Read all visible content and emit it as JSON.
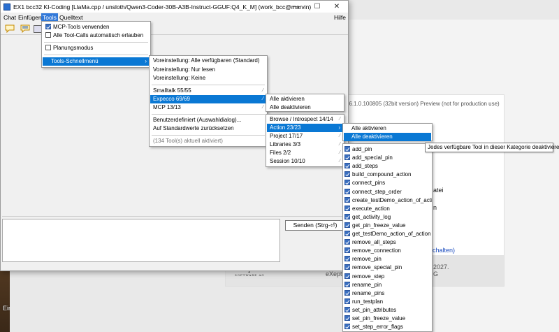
{
  "desktop": {
    "label": "Einga"
  },
  "background_app": {
    "version_text": "26.1.0.100805 (32bit version) Preview (not for production use)",
    "fragment_1": "atei",
    "fragment_2": "n",
    "link_fragment": "chalten)",
    "footer_1": "2027.",
    "footer_2": "G",
    "logo_text": "eXept",
    "logo_sub": "SOFTWARE AG",
    "logo_fragment": "eXept"
  },
  "window": {
    "title": "EX1 bcc32 KI-Coding [LlaMa.cpp / unsloth/Qwen3-Coder-30B-A3B-Instruct-GGUF:Q4_K_M] (work_bcc@marvin)",
    "controls": {
      "minimize": "—",
      "maximize": "☐",
      "close": "✕"
    }
  },
  "menubar": {
    "chat": "Chat",
    "einfuegen": "Einfügen",
    "tools": "Tools",
    "quelltext": "Quelltext",
    "hilfe": "Hilfe"
  },
  "toolbar": {
    "icons": [
      "speech-bubble-icon",
      "speech-bubble-list-icon",
      "window-icon"
    ]
  },
  "input": {
    "value": ""
  },
  "send_button": "Senden (Strg-⏎)",
  "tools_menu": {
    "mcp_tools": "MCP-Tools verwenden",
    "auto_allow": "Alle Tool-Calls automatisch erlauben",
    "planning_mode": "Planungsmodus",
    "quick_menu": "Tools-Schnellmenü",
    "quick_menu_arrow": "›"
  },
  "tools_submenu": {
    "preset_all": "Voreinstellung: Alle verfügbaren (Standard)",
    "preset_read": "Voreinstellung: Nur lesen",
    "preset_none": "Voreinstellung: Keine",
    "smalltalk": "Smalltalk  55/55",
    "expecco": "Expecco  69/69",
    "mcp": "MCP  13/13",
    "custom": "Benutzerdefiniert (Auswahldialog)...",
    "reset": "Auf Standardwerte zurücksetzen",
    "status": "(134 Tool(s) aktuell aktiviert)"
  },
  "expecco_menu": {
    "enable_all": "Alle aktivieren",
    "disable_all": "Alle deaktivieren"
  },
  "category_menu": {
    "browse": "Browse / Introspect  14/14",
    "action": "Action  23/23",
    "project": "Project  17/17",
    "libraries": "Libraries  3/3",
    "files": "Files  2/2",
    "session": "Session  10/10"
  },
  "action_menu": {
    "enable_all": "Alle aktivieren",
    "disable_all": "Alle deaktivieren"
  },
  "tooltip": "Jedes verfügbare Tool in dieser Kategorie deaktivieren",
  "tools": [
    "add_pin",
    "add_special_pin",
    "add_steps",
    "build_compound_action",
    "connect_pins",
    "connect_step_order",
    "create_testDemo_action_of_action",
    "execute_action",
    "get_activity_log",
    "get_pin_freeze_value",
    "get_testDemo_action_of_action",
    "remove_all_steps",
    "remove_connection",
    "remove_pin",
    "remove_special_pin",
    "remove_step",
    "rename_pin",
    "rename_pins",
    "run_testplan",
    "set_pin_attributes",
    "set_pin_freeze_value",
    "set_step_error_flags"
  ]
}
